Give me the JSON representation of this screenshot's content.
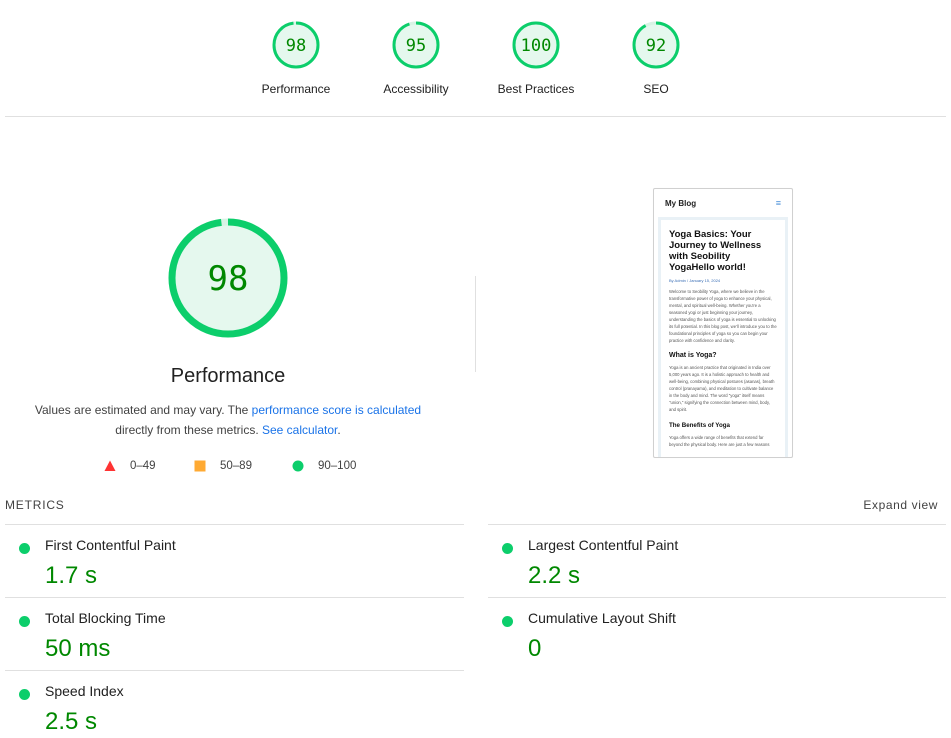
{
  "categories": [
    {
      "score": "98",
      "value": 98,
      "label": "Performance"
    },
    {
      "score": "95",
      "value": 95,
      "label": "Accessibility"
    },
    {
      "score": "100",
      "value": 100,
      "label": "Best Practices"
    },
    {
      "score": "92",
      "value": 92,
      "label": "SEO"
    }
  ],
  "performance": {
    "score": "98",
    "value": 98,
    "title": "Performance",
    "desc_prefix": "Values are estimated and may vary. The ",
    "desc_link1": "performance score is calculated",
    "desc_middle": " directly from these metrics. ",
    "desc_link2": "See calculator",
    "desc_suffix": "."
  },
  "legend": [
    {
      "range": "0–49",
      "shape": "triangle",
      "color": "#ff3333"
    },
    {
      "range": "50–89",
      "shape": "square",
      "color": "#ffaa33"
    },
    {
      "range": "90–100",
      "shape": "circle",
      "color": "#0cce6b"
    }
  ],
  "thumbnail": {
    "site_title": "My Blog",
    "menu_icon": "hamburger-icon",
    "headline": "Yoga Basics: Your Journey to Wellness with Seobility YogaHello world!",
    "meta": "By Admin / January 15, 2024",
    "para1": "Welcome to Seobility Yoga, where we believe in the transformative power of yoga to enhance your physical, mental, and spiritual well-being. Whether you're a seasoned yogi or just beginning your journey, understanding the basics of yoga is essential to unlocking its full potential. In this blog post, we'll introduce you to the foundational principles of yoga so you can begin your practice with confidence and clarity.",
    "h2": "What is Yoga?",
    "para2": "Yoga is an ancient practice that originated in India over 5,000 years ago. It is a holistic approach to health and well-being, combining physical postures (asanas), breath control (pranayama), and meditation to cultivate balance in the body and mind. The word \"yoga\" itself means \"union,\" signifying the connection between mind, body, and spirit.",
    "h3": "The Benefits of Yoga",
    "para3": "Yoga offers a wide range of benefits that extend far beyond the physical body. Here are just a few reasons"
  },
  "metrics_section": {
    "label": "METRICS",
    "expand_label": "Expand view",
    "items": [
      {
        "name": "First Contentful Paint",
        "value": "1.7 s"
      },
      {
        "name": "Largest Contentful Paint",
        "value": "2.2 s"
      },
      {
        "name": "Total Blocking Time",
        "value": "50 ms"
      },
      {
        "name": "Cumulative Layout Shift",
        "value": "0"
      },
      {
        "name": "Speed Index",
        "value": "2.5 s"
      }
    ]
  },
  "colors": {
    "pass": "#0cce6b",
    "pass_text": "#008800",
    "pass_fill": "#e5f8ee",
    "link": "#1a73e8"
  }
}
